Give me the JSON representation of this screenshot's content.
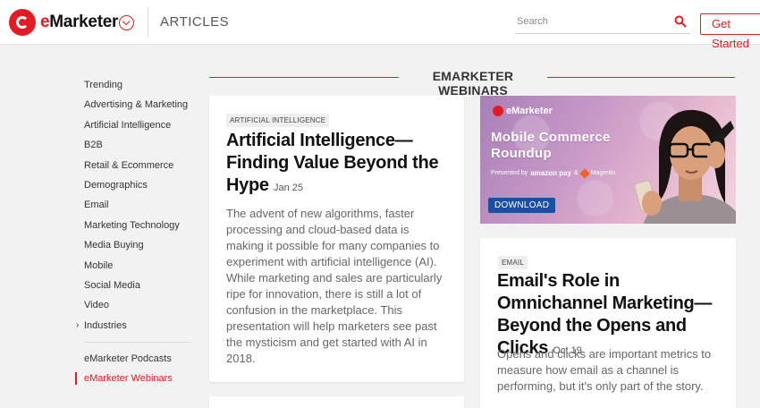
{
  "brand": {
    "logo_text_e": "e",
    "logo_text_rest": "Marketer"
  },
  "header": {
    "section": "ARTICLES",
    "search_placeholder": "Search",
    "get_started": "Get Started"
  },
  "sidebar": {
    "items": [
      {
        "label": "Trending"
      },
      {
        "label": "Advertising & Marketing"
      },
      {
        "label": "Artificial Intelligence"
      },
      {
        "label": "B2B"
      },
      {
        "label": "Retail & Ecommerce"
      },
      {
        "label": "Demographics"
      },
      {
        "label": "Email"
      },
      {
        "label": "Marketing Technology"
      },
      {
        "label": "Media Buying"
      },
      {
        "label": "Mobile"
      },
      {
        "label": "Social Media"
      },
      {
        "label": "Video"
      },
      {
        "label": "Industries"
      }
    ],
    "secondary": [
      {
        "label": "eMarketer Podcasts"
      },
      {
        "label": "eMarketer Webinars"
      }
    ]
  },
  "section_title": "EMARKETER WEBINARS",
  "cards": [
    {
      "tag": "ARTIFICIAL INTELLIGENCE",
      "title": "Artificial Intelligence— Finding Value Beyond the Hype",
      "date": "Jan 25",
      "description": "The advent of new algorithms, faster processing and cloud-based data is making it possible for many companies to experiment with artificial intelligence (AI). While marketing and sales are particularly ripe for innovation, there is still a lot of confusion in the marketplace. This presentation will help marketers see past the mysticism and get started with AI in 2018."
    },
    {
      "tag": "EMAIL",
      "title": "Email's Role in Omnichannel Marketing—Beyond the Opens and Clicks",
      "date": "Oct 19",
      "description": "Opens and clicks are important metrics to measure how email as a channel is performing, but it's only part of the story."
    }
  ],
  "banner": {
    "logo": "eMarketer",
    "title_line1": "Mobile Commerce",
    "title_line2": "Roundup",
    "presented_by": "Presented by",
    "sponsor1": "amazon pay",
    "amp": "&",
    "sponsor2": "Magento",
    "cta": "DOWNLOAD"
  },
  "colors": {
    "accent": "#e31b23",
    "cta_blue": "#1b4fa3"
  }
}
